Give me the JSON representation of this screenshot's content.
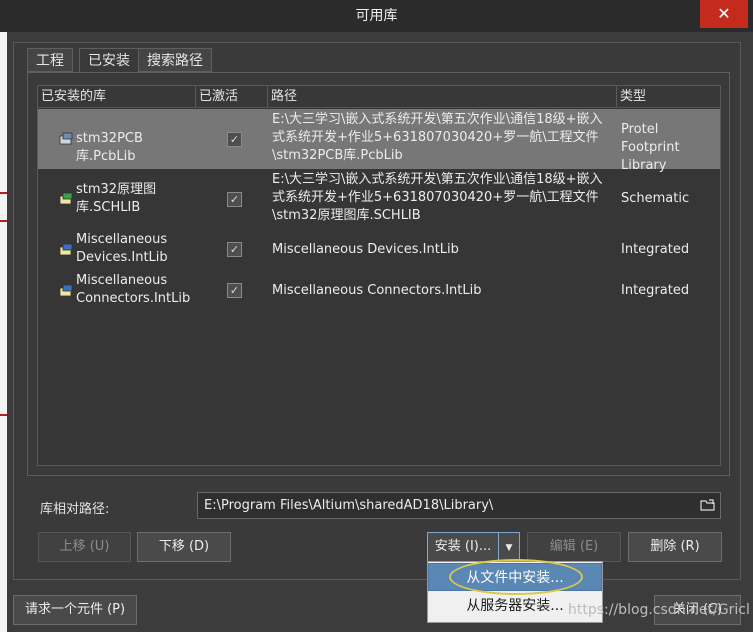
{
  "window": {
    "title": "可用库",
    "close_glyph": "✕"
  },
  "tabs": [
    {
      "label": "工程",
      "active": false
    },
    {
      "label": "已安装",
      "active": true
    },
    {
      "label": "搜索路径",
      "active": false
    }
  ],
  "table": {
    "columns": [
      "已安装的库",
      "已激活",
      "路径",
      "类型"
    ],
    "rows": [
      {
        "name": "stm32PCB库.PcbLib",
        "active": true,
        "path": "E:\\大三学习\\嵌入式系统开发\\第五次作业\\通信18级+嵌入式系统开发+作业5+631807030420+罗一航\\工程文件\\stm32PCB库.PcbLib",
        "type": "Protel Footprint Library",
        "selected": true,
        "icon": "pcb-library-icon"
      },
      {
        "name": "stm32原理图库.SCHLIB",
        "active": true,
        "path": "E:\\大三学习\\嵌入式系统开发\\第五次作业\\通信18级+嵌入式系统开发+作业5+631807030420+罗一航\\工程文件\\stm32原理图库.SCHLIB",
        "type": "Schematic",
        "selected": false,
        "icon": "schematic-library-icon"
      },
      {
        "name": "Miscellaneous Devices.IntLib",
        "active": true,
        "path": "Miscellaneous Devices.IntLib",
        "type": "Integrated",
        "selected": false,
        "icon": "integrated-library-icon"
      },
      {
        "name": "Miscellaneous Connectors.IntLib",
        "active": true,
        "path": "Miscellaneous Connectors.IntLib",
        "type": "Integrated",
        "selected": false,
        "icon": "integrated-library-icon"
      }
    ]
  },
  "path_field": {
    "label": "库相对路径:",
    "value": "E:\\Program Files\\Altium\\sharedAD18\\Library\\"
  },
  "buttons": {
    "move_up": "上移 (U)",
    "move_down": "下移 (D)",
    "install": "安装 (I)...",
    "edit": "编辑 (E)",
    "remove": "删除 (R)",
    "request_component": "请求一个元件 (P)",
    "close": "关闭 (C)"
  },
  "install_menu": [
    "从文件中安装...",
    "从服务器安装..."
  ],
  "watermark": "https://blog.csdn.net/Gricl",
  "colors": {
    "dialog_bg": "#3a3a3a",
    "selected_row": "#777777",
    "menu_highlight": "#5b87b5",
    "close_red": "#c42b1c"
  }
}
